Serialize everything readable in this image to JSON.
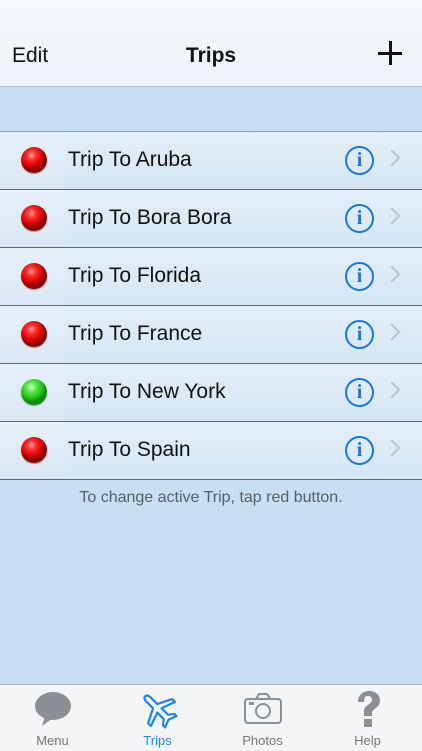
{
  "nav": {
    "edit_label": "Edit",
    "title": "Trips",
    "add_icon": "plus-icon"
  },
  "trips": [
    {
      "label": "Trip To Aruba",
      "status": "inactive",
      "color": "#d40000"
    },
    {
      "label": "Trip To Bora Bora",
      "status": "inactive",
      "color": "#d40000"
    },
    {
      "label": "Trip To Florida",
      "status": "inactive",
      "color": "#d40000"
    },
    {
      "label": "Trip To France",
      "status": "inactive",
      "color": "#d40000"
    },
    {
      "label": "Trip To New York",
      "status": "active",
      "color": "#20c414"
    },
    {
      "label": "Trip To Spain",
      "status": "inactive",
      "color": "#d40000"
    }
  ],
  "hint": "To change active Trip, tap red button.",
  "tabbar": {
    "tabs": [
      {
        "label": "Menu",
        "icon": "speech-bubble-icon",
        "active": false
      },
      {
        "label": "Trips",
        "icon": "airplane-icon",
        "active": true
      },
      {
        "label": "Photos",
        "icon": "camera-icon",
        "active": false
      },
      {
        "label": "Help",
        "icon": "question-mark-icon",
        "active": false
      }
    ]
  },
  "colors": {
    "accent": "#1b86e8",
    "info_blue": "#1977d6",
    "background": "#c5def2"
  }
}
